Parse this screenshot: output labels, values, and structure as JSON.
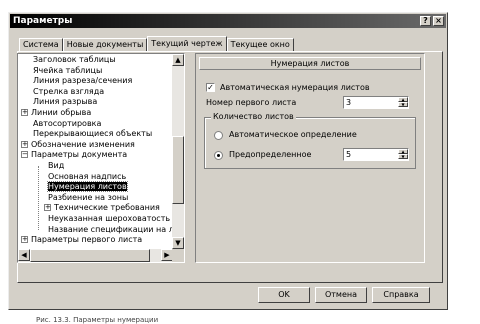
{
  "window": {
    "title": "Параметры",
    "help_glyph": "?",
    "close_glyph": "×"
  },
  "tabs": [
    {
      "label": "Система"
    },
    {
      "label": "Новые документы"
    },
    {
      "label": "Текущий чертеж"
    },
    {
      "label": "Текущее окно"
    }
  ],
  "active_tab": "Текущий чертеж",
  "tree": {
    "items": [
      {
        "label": "Заголовок таблицы",
        "expander": ""
      },
      {
        "label": "Ячейка таблицы",
        "expander": ""
      },
      {
        "label": "Линия разреза/сечения",
        "expander": ""
      },
      {
        "label": "Стрелка взгляда",
        "expander": ""
      },
      {
        "label": "Линия разрыва",
        "expander": ""
      },
      {
        "label": "Линии обрыва",
        "expander": "+"
      },
      {
        "label": "Автосортировка",
        "expander": ""
      },
      {
        "label": "Перекрывающиеся объекты",
        "expander": ""
      },
      {
        "label": "Обозначение изменения",
        "expander": "+"
      },
      {
        "label": "Параметры документа",
        "expander": "−"
      },
      {
        "label": "Вид",
        "expander": ""
      },
      {
        "label": "Основная надпись",
        "expander": ""
      },
      {
        "label": "Нумерация листов",
        "expander": "",
        "selected": true
      },
      {
        "label": "Разбиение на зоны",
        "expander": ""
      },
      {
        "label": "Технические требования",
        "expander": "+"
      },
      {
        "label": "Неуказанная шероховатость",
        "expander": ""
      },
      {
        "label": "Название спецификации на лист",
        "expander": ""
      },
      {
        "label": "Параметры первого листа",
        "expander": "+"
      }
    ]
  },
  "panel": {
    "header": "Нумерация листов",
    "auto_numbering": {
      "label": "Автоматическая нумерация листов",
      "checked": true
    },
    "first_sheet": {
      "label": "Номер первого листа",
      "value": "3"
    },
    "sheet_count": {
      "legend": "Количество листов",
      "auto_label": "Автоматическое определение",
      "preset_label": "Предопределенное",
      "preset_value": "5",
      "selected": "Предопределенное"
    }
  },
  "buttons": {
    "ok": "OK",
    "cancel": "Отмена",
    "help": "Справка"
  },
  "caption": "Рис. 13.3. Параметры нумерации"
}
